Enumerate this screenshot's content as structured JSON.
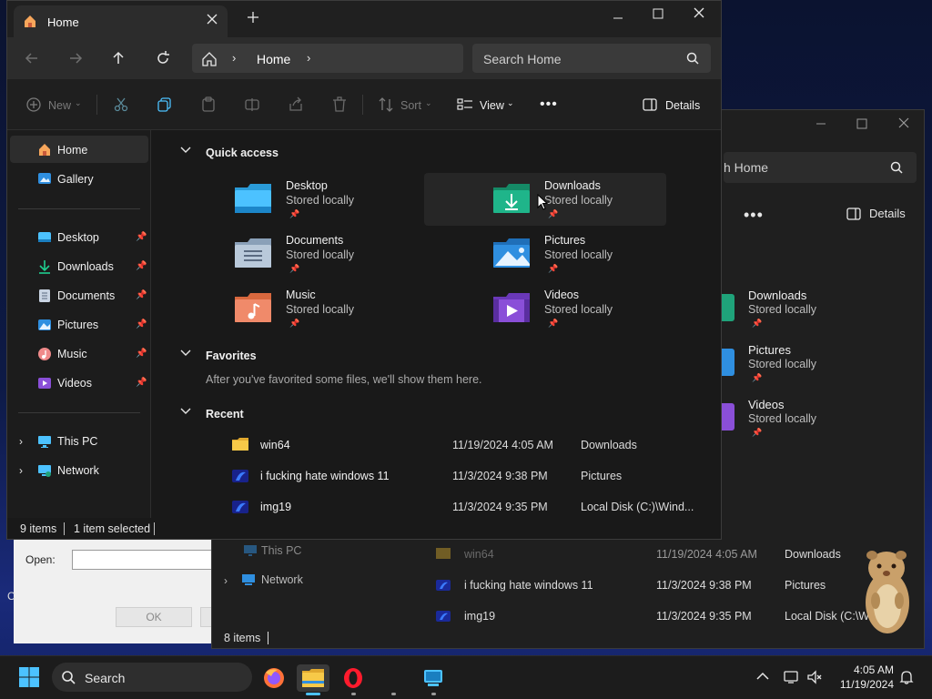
{
  "background": {
    "run_dialog": {
      "open_label": "Open:",
      "ok_label": "OK"
    },
    "explorer": {
      "search_partial": "h Home",
      "more_label": "•••",
      "details_label": "Details",
      "tiles": [
        {
          "name": "Downloads",
          "sub": "Stored locally"
        },
        {
          "name": "Pictures",
          "sub": "Stored locally"
        },
        {
          "name": "Videos",
          "sub": "Stored locally"
        }
      ],
      "nav": {
        "this_pc": "This PC",
        "network": "Network"
      },
      "recent": [
        {
          "name": "win64",
          "date": "11/19/2024 4:05 AM",
          "loc": "Downloads"
        },
        {
          "name": "i fucking hate windows 11",
          "date": "11/3/2024 9:38 PM",
          "loc": "Pictures"
        },
        {
          "name": "img19",
          "date": "11/3/2024 9:35 PM",
          "loc": "Local Disk (C:\\W"
        }
      ],
      "status": "8 items"
    }
  },
  "window": {
    "tab_title": "Home",
    "toolbar": {
      "new_label": "New",
      "sort_label": "Sort",
      "view_label": "View",
      "more_label": "•••",
      "details_label": "Details"
    },
    "address": {
      "crumb": "Home"
    },
    "search": {
      "placeholder": "Search Home"
    },
    "sidebar": {
      "home": "Home",
      "gallery": "Gallery",
      "pinned": [
        {
          "label": "Desktop",
          "icon": "desktop-icon"
        },
        {
          "label": "Downloads",
          "icon": "download-icon"
        },
        {
          "label": "Documents",
          "icon": "document-icon"
        },
        {
          "label": "Pictures",
          "icon": "picture-icon"
        },
        {
          "label": "Music",
          "icon": "music-icon"
        },
        {
          "label": "Videos",
          "icon": "video-icon"
        }
      ],
      "this_pc": "This PC",
      "network": "Network"
    },
    "quick_access": {
      "title": "Quick access",
      "tiles": [
        {
          "name": "Desktop",
          "sub": "Stored locally"
        },
        {
          "name": "Downloads",
          "sub": "Stored locally"
        },
        {
          "name": "Documents",
          "sub": "Stored locally"
        },
        {
          "name": "Pictures",
          "sub": "Stored locally"
        },
        {
          "name": "Music",
          "sub": "Stored locally"
        },
        {
          "name": "Videos",
          "sub": "Stored locally"
        }
      ]
    },
    "favorites": {
      "title": "Favorites",
      "note": "After you've favorited some files, we'll show them here."
    },
    "recent": {
      "title": "Recent",
      "rows": [
        {
          "name": "win64",
          "date": "11/19/2024 4:05 AM",
          "loc": "Downloads"
        },
        {
          "name": "i fucking hate windows 11",
          "date": "11/3/2024 9:38 PM",
          "loc": "Pictures"
        },
        {
          "name": "img19",
          "date": "11/3/2024 9:35 PM",
          "loc": "Local Disk (C:)\\Wind..."
        }
      ]
    },
    "status": {
      "items": "9 items",
      "selected": "1 item selected"
    }
  },
  "taskbar": {
    "search_label": "Search",
    "time": "4:05 AM",
    "date": "11/19/2024"
  },
  "colors": {
    "accent": "#4cc2ff",
    "folder_yellow": "#f7c948",
    "downloads_green": "#1fa37a",
    "music_orange": "#f08a5d",
    "videos_purple": "#8a4fd8",
    "pictures_blue": "#2f8fe0"
  }
}
